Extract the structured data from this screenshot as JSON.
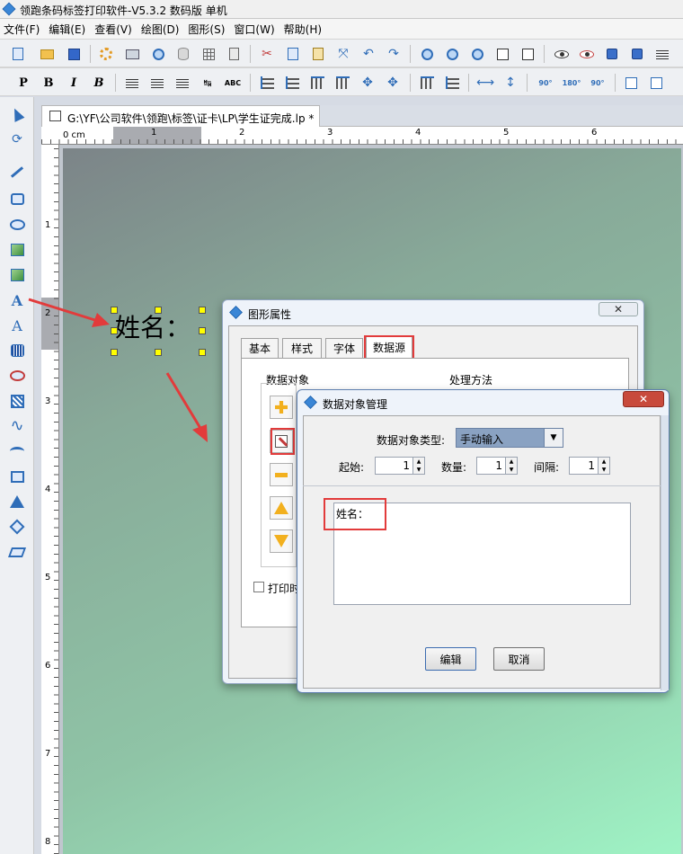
{
  "window": {
    "title": "领跑条码标签打印软件-V5.3.2 数码版 单机"
  },
  "menu": {
    "items": [
      "文件(F)",
      "编辑(E)",
      "查看(V)",
      "绘图(D)",
      "图形(S)",
      "窗口(W)",
      "帮助(H)"
    ]
  },
  "toolbar2": {
    "bold": "P",
    "b2": "B",
    "italic": "I",
    "b3": "B",
    "small_abc": "ABC",
    "rot90": "90°",
    "rot180": "180°",
    "rot90b": "90°"
  },
  "document": {
    "tab_title": "G:\\YF\\公司软件\\领跑\\标签\\证卡\\LP\\学生证完成.lp *"
  },
  "ruler": {
    "unit": "0 cm",
    "h_marks": [
      "1",
      "2",
      "3",
      "4",
      "5",
      "6"
    ],
    "v_marks": [
      "1",
      "2",
      "3",
      "4",
      "5",
      "6",
      "7",
      "8"
    ]
  },
  "canvas": {
    "text_object": "姓名："
  },
  "prop_dialog": {
    "title": "图形属性",
    "close": "✕",
    "tabs": [
      "基本",
      "样式",
      "字体",
      "数据源"
    ],
    "group_data_object": "数据对象",
    "group_processing": "处理方法",
    "print_checkbox": "打印时"
  },
  "dm_dialog": {
    "title": "数据对象管理",
    "close": "✕",
    "type_label": "数据对象类型:",
    "type_value": "手动输入",
    "start_label": "起始:",
    "start_value": "1",
    "count_label": "数量:",
    "count_value": "1",
    "interval_label": "间隔:",
    "interval_value": "1",
    "content": "姓名：",
    "edit_button": "编辑",
    "cancel_button": "取消"
  },
  "colors": {
    "highlight": "#e23b3b",
    "handle": "#ffff00",
    "accent": "#2f6db8"
  }
}
